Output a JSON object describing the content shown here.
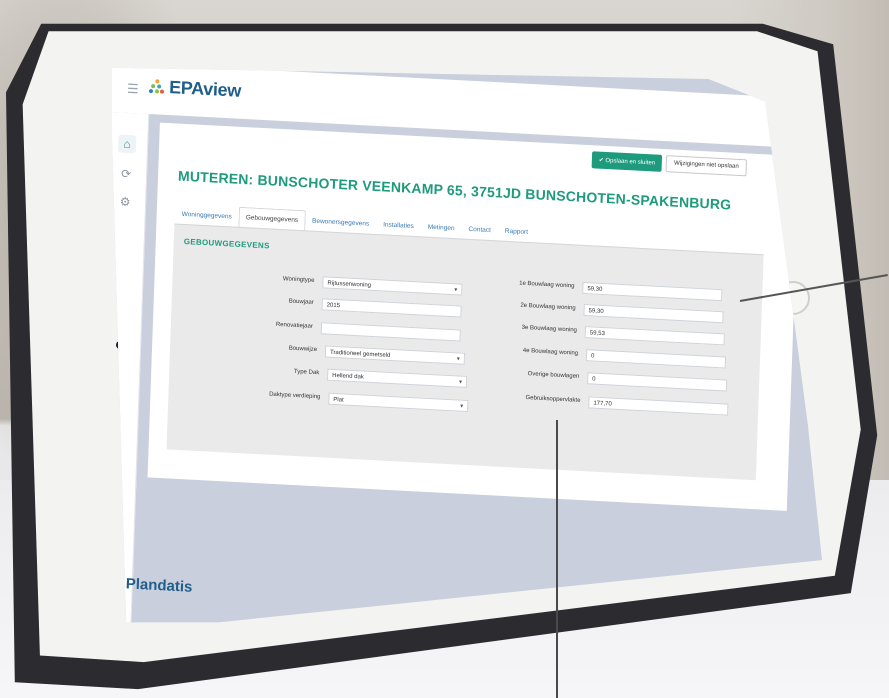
{
  "app": {
    "logo_text": "EPAview",
    "brand_footer": "Plandatis"
  },
  "header": {
    "actions": [
      "✔ Opslaan en sluiten",
      "Wijzigingen niet opslaan"
    ]
  },
  "page_title": "MUTEREN: BUNSCHOTER VEENKAMP 65, 3751JD BUNSCHOTEN-SPAKENBURG",
  "tabs": [
    {
      "label": "Woninggegevens",
      "active": false
    },
    {
      "label": "Gebouwgegevens",
      "active": true
    },
    {
      "label": "Bewonersgegevens",
      "active": false
    },
    {
      "label": "Installaties",
      "active": false
    },
    {
      "label": "Metingen",
      "active": false
    },
    {
      "label": "Contact",
      "active": false
    },
    {
      "label": "Rapport",
      "active": false
    }
  ],
  "section_title": "GEBOUWGEGEVENS",
  "left_fields": [
    {
      "label": "Woningtype",
      "value": "Rijtussenwoning",
      "type": "select"
    },
    {
      "label": "Bouwjaar",
      "value": "2015",
      "type": "input"
    },
    {
      "label": "Renovatiejaar",
      "value": "",
      "type": "input"
    },
    {
      "label": "Bouwwijze",
      "value": "Traditioneel gemetseld",
      "type": "select"
    },
    {
      "label": "Type Dak",
      "value": "Hellend dak",
      "type": "select"
    },
    {
      "label": "Daktype verdieping",
      "value": "Plat",
      "type": "select"
    }
  ],
  "right_fields": [
    {
      "label": "1e Bouwlaag woning",
      "value": "59,30"
    },
    {
      "label": "2e Bouwlaag woning",
      "value": "59,30"
    },
    {
      "label": "3e Bouwlaag woning",
      "value": "59,53"
    },
    {
      "label": "4e Bouwlaag woning",
      "value": "0"
    },
    {
      "label": "Overige bouwlagen",
      "value": "0"
    },
    {
      "label": "Gebruiksoppervlakte",
      "value": "177,70"
    }
  ],
  "icons": {
    "menu": "hamburger-icon",
    "home": "home-icon",
    "refresh": "refresh-icon",
    "settings": "gear-icon"
  },
  "colors": {
    "accent": "#1e9a7d",
    "brand": "#1f5e8b",
    "link": "#3a7ab4"
  }
}
